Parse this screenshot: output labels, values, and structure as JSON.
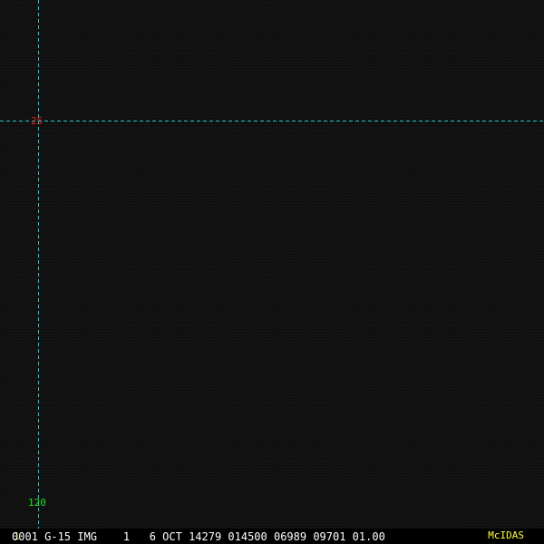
{
  "colors": {
    "grid_line": "#1ec8c8",
    "latitude_label": "#e02020",
    "longitude_label": "#20e020",
    "status_text": "#ffffff",
    "frame_number": "#ffd700",
    "brand": "#ffff40",
    "background": "#121212"
  },
  "map": {
    "grid": {
      "latitude_label": "25",
      "longitude_label": "120"
    }
  },
  "status_bar": {
    "frame_number": "1",
    "text": "0001 G-15 IMG    1   6 OCT 14279 014500 06989 09701 01.00",
    "brand": "McIDAS"
  }
}
